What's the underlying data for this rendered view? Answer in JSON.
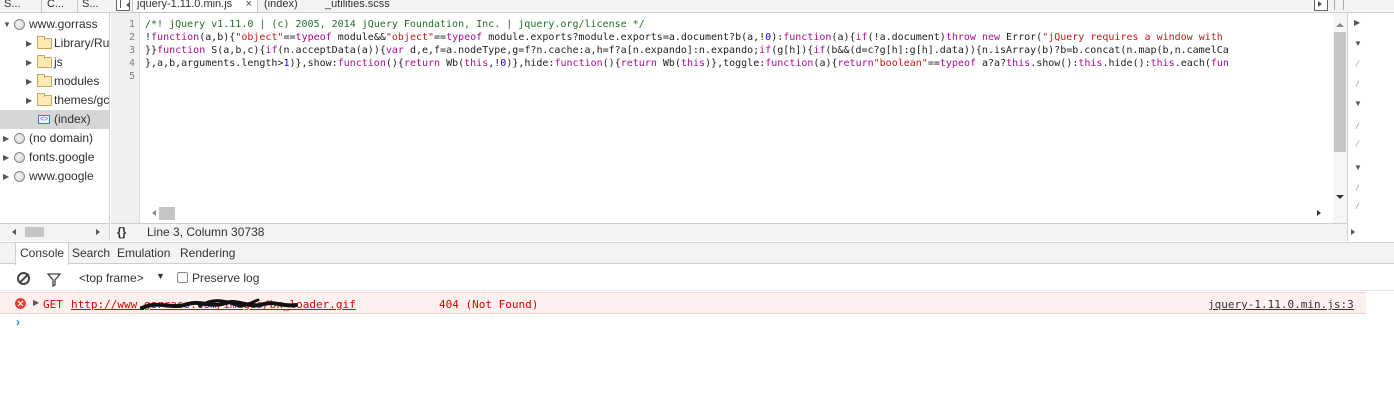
{
  "navigator_tabs": [
    {
      "label": "S..."
    },
    {
      "label": "C..."
    },
    {
      "label": "S..."
    }
  ],
  "editor_tabs": [
    {
      "label": "jquery-1.11.0.min.js",
      "close": "×",
      "active": true
    },
    {
      "label": "(index)",
      "active": false
    },
    {
      "label": "_utilities.scss",
      "active": false
    }
  ],
  "navigator": {
    "items": [
      {
        "label": "www.gorrass",
        "type": "domain",
        "expanded": true
      },
      {
        "label": "Library/Ru",
        "type": "folder"
      },
      {
        "label": "js",
        "type": "folder"
      },
      {
        "label": "modules",
        "type": "folder"
      },
      {
        "label": "themes/gc",
        "type": "folder"
      },
      {
        "label": "(index)",
        "type": "file",
        "selected": true
      },
      {
        "label": "(no domain)",
        "type": "domain"
      },
      {
        "label": "fonts.google",
        "type": "domain"
      },
      {
        "label": "www.google",
        "type": "domain"
      }
    ]
  },
  "editor": {
    "line_numbers": [
      "1",
      "2",
      "3",
      "4",
      "5"
    ]
  },
  "statusbar": {
    "pretty_print": "{}",
    "cursor": "Line 3, Column 30738"
  },
  "drawer_tabs": {
    "console": "Console",
    "search": "Search",
    "emulation": "Emulation",
    "rendering": "Rendering"
  },
  "console_toolbar": {
    "frame": "<top frame>",
    "frame_arrow": "▼",
    "preserve_log": "Preserve log",
    "preserve_checked": false
  },
  "console": {
    "error": {
      "method": "GET",
      "url": "http://www.gorrass.com/images/bx_loader.gif",
      "status": "404 (Not Found)",
      "source": "jquery-1.11.0.min.js:3"
    },
    "prompt": "›"
  },
  "colors": {
    "error_bg": "#fff0f0",
    "error_text": "#dd0000",
    "comment": "#236e25",
    "keyword": "#aa0d91",
    "string": "#c41a16",
    "prompt": "#2c83e6"
  }
}
